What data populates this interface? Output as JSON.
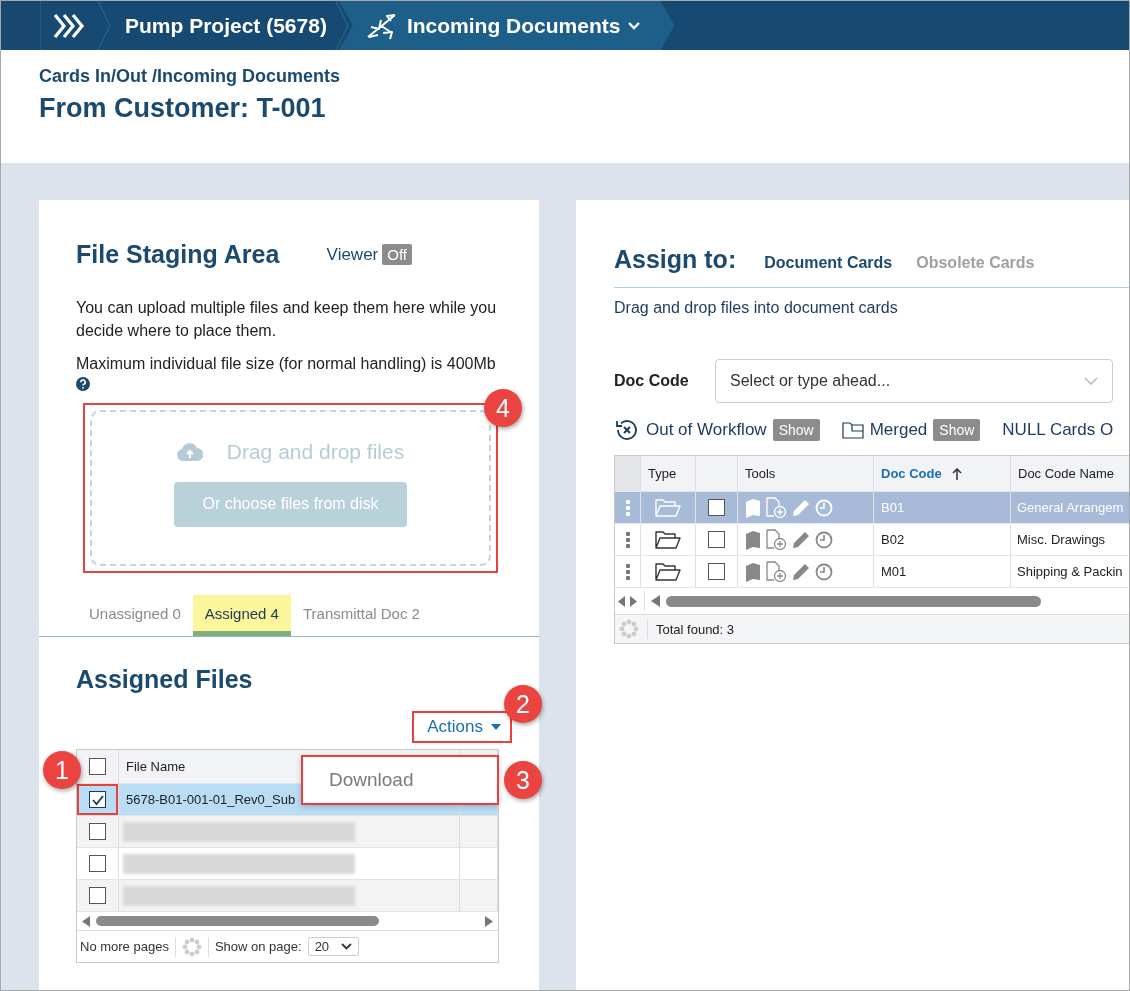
{
  "topbar": {
    "breadcrumbs": [
      {
        "label": "Pump Project (5678)",
        "selected": false
      },
      {
        "label": "Incoming Documents",
        "selected": true
      }
    ]
  },
  "header": {
    "path": "Cards In/Out /Incoming Documents",
    "title": "From Customer: T-001"
  },
  "staging": {
    "title": "File Staging Area",
    "viewer_label": "Viewer",
    "viewer_state": "Off",
    "description": "You can upload multiple files and keep them here while you decide where to place them.",
    "size_note": "Maximum individual file size (for normal handling) is 400Mb",
    "dropzone": {
      "prompt": "Drag and drop files",
      "button": "Or choose files from disk",
      "callout": "4"
    },
    "tabs": [
      {
        "label": "Unassigned 0",
        "selected": false
      },
      {
        "label": "Assigned 4",
        "selected": true
      },
      {
        "label": "Transmittal Doc 2",
        "selected": false
      }
    ]
  },
  "assigned": {
    "title": "Assigned Files",
    "actions": {
      "label": "Actions",
      "callout": "2"
    },
    "menu": {
      "items": [
        "Download"
      ],
      "callout": "3"
    },
    "table": {
      "columns": [
        "File Name"
      ],
      "header_checked": false,
      "rows": [
        {
          "kind": "file",
          "name": "5678-B01-001-01_Rev0_Sub",
          "checked": true,
          "selected": true,
          "callout": "1"
        },
        {
          "kind": "redacted",
          "checked": false,
          "selected": false
        },
        {
          "kind": "redacted",
          "checked": false,
          "selected": false
        },
        {
          "kind": "redacted",
          "checked": false,
          "selected": false
        }
      ]
    },
    "pager": {
      "status": "No more pages",
      "page_size_label": "Show on page:",
      "page_size": "20"
    }
  },
  "assign": {
    "title": "Assign to:",
    "tabs": [
      {
        "label": "Document Cards",
        "selected": true
      },
      {
        "label": "Obsolete Cards",
        "selected": false
      }
    ],
    "hint": "Drag and drop files into document cards",
    "doc_code": {
      "label": "Doc Code",
      "placeholder": "Select or type ahead..."
    },
    "filters": [
      {
        "kind": "workflow",
        "label": "Out of Workflow",
        "button": "Show"
      },
      {
        "kind": "merged",
        "label": "Merged",
        "button": "Show"
      },
      {
        "kind": "plain",
        "label": "NULL Cards O"
      }
    ],
    "table": {
      "columns": [
        {
          "label": "Type",
          "sorted": false
        },
        {
          "label": "Tools",
          "sorted": false
        },
        {
          "label": "Doc Code",
          "sorted": true
        },
        {
          "label": "Doc Code Name",
          "sorted": false
        }
      ],
      "rows": [
        {
          "code": "B01",
          "name": "General Arrangem",
          "checked": false,
          "selected": true
        },
        {
          "code": "B02",
          "name": "Misc. Drawings",
          "checked": false,
          "selected": false
        },
        {
          "code": "M01",
          "name": "Shipping & Packin",
          "checked": false,
          "selected": false
        }
      ],
      "footer": "Total found: 3"
    }
  }
}
